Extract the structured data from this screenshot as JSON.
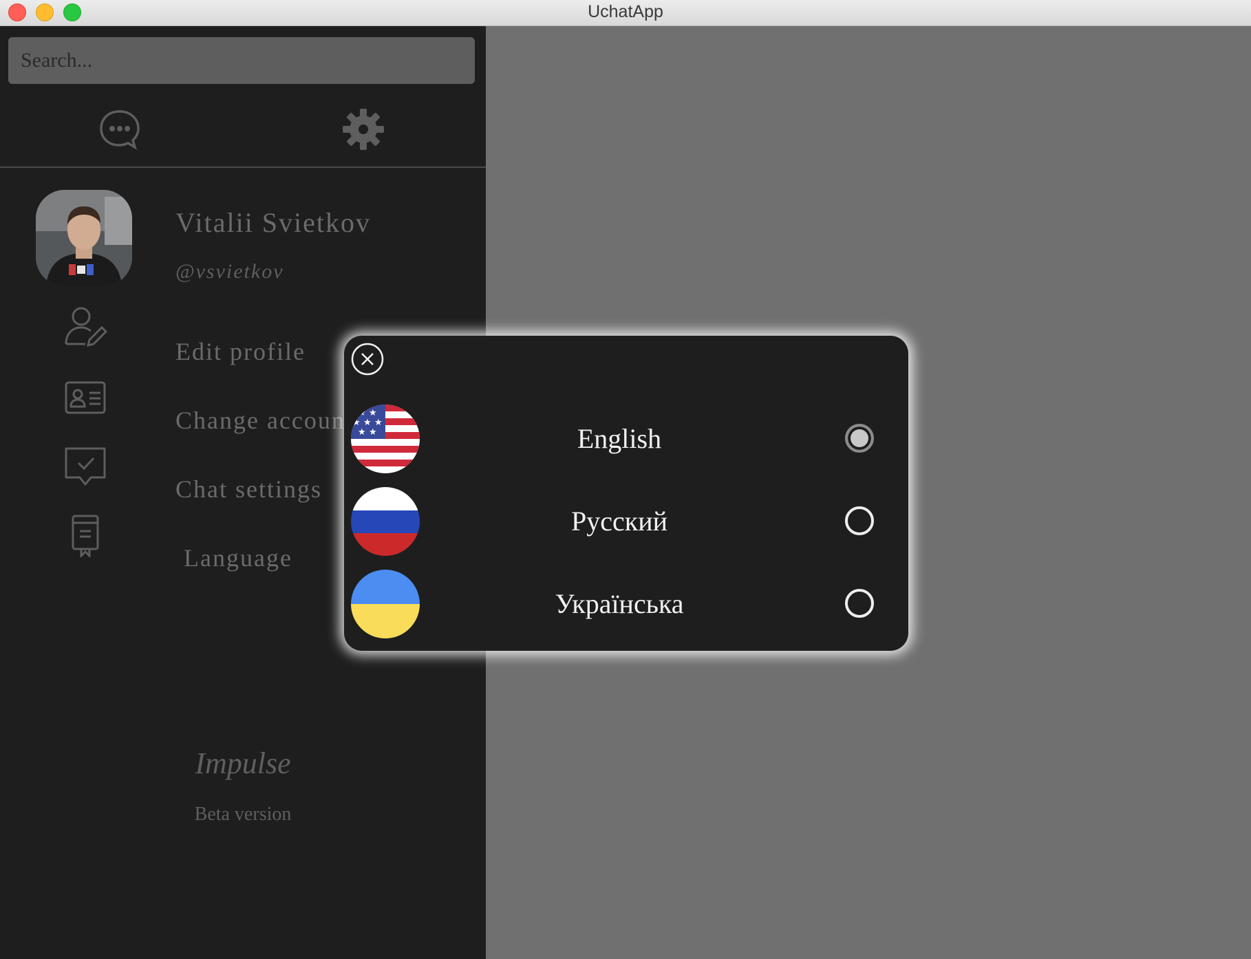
{
  "window": {
    "title": "UchatApp"
  },
  "search": {
    "placeholder": "Search..."
  },
  "nav": {
    "chats_icon": "chat-bubble-icon",
    "settings_icon": "gear-icon"
  },
  "profile": {
    "name": "Vitalii Svietkov",
    "handle": "@vsvietkov",
    "avatar": "profile-photo"
  },
  "menu": [
    {
      "label": "Edit profile",
      "icon": "user-edit-icon"
    },
    {
      "label": "Change account",
      "icon": "id-card-icon"
    },
    {
      "label": "Chat settings",
      "icon": "chat-check-icon"
    },
    {
      "label": "Language",
      "icon": "document-icon"
    }
  ],
  "footer": {
    "brand": "Impulse",
    "version": "Beta version"
  },
  "language_dialog": {
    "close_icon": "close-icon",
    "options": [
      {
        "label": "English",
        "flag": "us-flag",
        "selected": true
      },
      {
        "label": "Русский",
        "flag": "russia-flag",
        "selected": false
      },
      {
        "label": "Українська",
        "flag": "ukraine-flag",
        "selected": false
      }
    ]
  },
  "colors": {
    "sidebar_bg": "#1e1e1e",
    "overlay": "#707070",
    "modal_bg": "#1e1e1e",
    "text_dim": "#6b6b6b",
    "text_bright": "#f2f2f2"
  }
}
